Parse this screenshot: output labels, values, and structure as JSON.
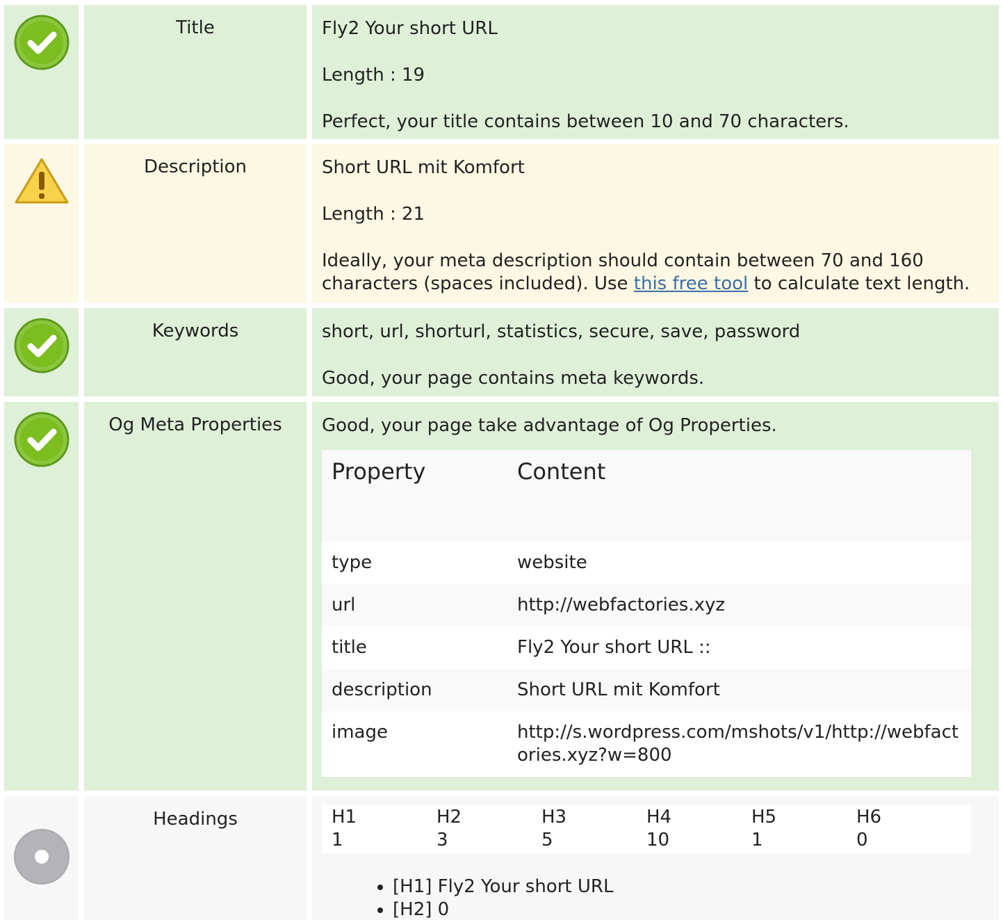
{
  "title_row": {
    "label": "Title",
    "value": "Fly2 Your short URL",
    "length": "Length : 19",
    "message": "Perfect, your title contains between 10 and 70 characters."
  },
  "description_row": {
    "label": "Description",
    "value": "Short URL mit Komfort",
    "length": "Length : 21",
    "message_before": "Ideally, your meta description should contain between 70 and 160 characters (spaces included). Use ",
    "link_text": "this free tool",
    "message_after": " to calculate text length."
  },
  "keywords_row": {
    "label": "Keywords",
    "value": "short, url, shorturl, statistics, secure, save, password",
    "message": "Good, your page contains meta keywords."
  },
  "og_row": {
    "label": "Og Meta Properties",
    "message": "Good, your page take advantage of Og Properties.",
    "headers": [
      "Property",
      "Content"
    ],
    "rows": [
      {
        "property": "type",
        "content": "website"
      },
      {
        "property": "url",
        "content": "http://webfactories.xyz"
      },
      {
        "property": "title",
        "content": "Fly2 Your short URL ::"
      },
      {
        "property": "description",
        "content": "Short URL mit Komfort"
      },
      {
        "property": "image",
        "content": "http://s.wordpress.com/mshots/v1/http://webfactories.xyz?w=800"
      }
    ]
  },
  "headings_row": {
    "label": "Headings",
    "levels": [
      {
        "name": "H1",
        "count": "1"
      },
      {
        "name": "H2",
        "count": "3"
      },
      {
        "name": "H3",
        "count": "5"
      },
      {
        "name": "H4",
        "count": "10"
      },
      {
        "name": "H5",
        "count": "1"
      },
      {
        "name": "H6",
        "count": "0"
      }
    ],
    "list": [
      "[H1] Fly2 Your short URL",
      "[H2] 0"
    ]
  },
  "icons": {
    "ok": "check-circle-icon",
    "warn": "warning-triangle-icon",
    "neutral": "info-dot-icon"
  },
  "colors": {
    "ok_bg": "#dff0d8",
    "warn_bg": "#fcf8e3",
    "neutral_bg": "#f7f7f7",
    "check_green": "#7cbd1f",
    "warn_yellow": "#f5c02d",
    "link": "#3b6ea5"
  }
}
